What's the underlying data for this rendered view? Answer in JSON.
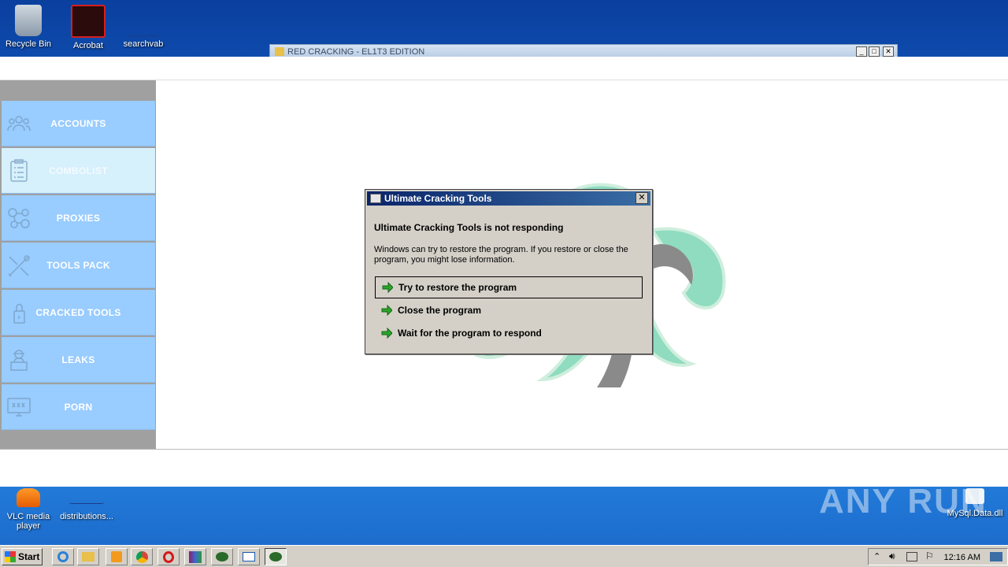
{
  "desktop": {
    "icons_top": [
      {
        "name": "recycle-bin",
        "label": "Recycle Bin"
      },
      {
        "name": "acrobat",
        "label": "Acrobat"
      },
      {
        "name": "searchvab",
        "label": "searchvab"
      }
    ],
    "icons_bottom": [
      {
        "name": "vlc",
        "label": "VLC media player"
      },
      {
        "name": "distributions",
        "label": "distributions..."
      },
      {
        "name": "mysql",
        "label": "MySql.Data.dll"
      }
    ]
  },
  "background_window": {
    "title": "RED CRACKING - EL1T3 EDITION"
  },
  "app": {
    "nav": [
      {
        "label": "ACCOUNTS",
        "icon": "users-icon"
      },
      {
        "label": "COMBOLIST",
        "icon": "clipboard-icon",
        "active": true
      },
      {
        "label": "PROXIES",
        "icon": "network-icon"
      },
      {
        "label": "TOOLS PACK",
        "icon": "tools-icon"
      },
      {
        "label": "CRACKED TOOLS",
        "icon": "padlock-icon"
      },
      {
        "label": "LEAKS",
        "icon": "hacker-icon"
      },
      {
        "label": "PORN",
        "icon": "xxx-monitor-icon"
      }
    ]
  },
  "dialog": {
    "title": "Ultimate Cracking Tools",
    "heading": "Ultimate Cracking Tools is not responding",
    "description": "Windows can try to restore the program. If you restore or close the program, you might lose information.",
    "options": [
      {
        "label": "Try to restore the program",
        "focused": true
      },
      {
        "label": "Close the program"
      },
      {
        "label": "Wait for the program to respond"
      }
    ],
    "close_glyph": "✕"
  },
  "taskbar": {
    "start_label": "Start",
    "clock": "12:16 AM"
  },
  "watermark": "ANY RUN",
  "colors": {
    "nav_bg": "#99ccff",
    "nav_active": "#d6f0fc",
    "accent_green": "#8fdcc0",
    "dialog_title": "#0a246a"
  }
}
